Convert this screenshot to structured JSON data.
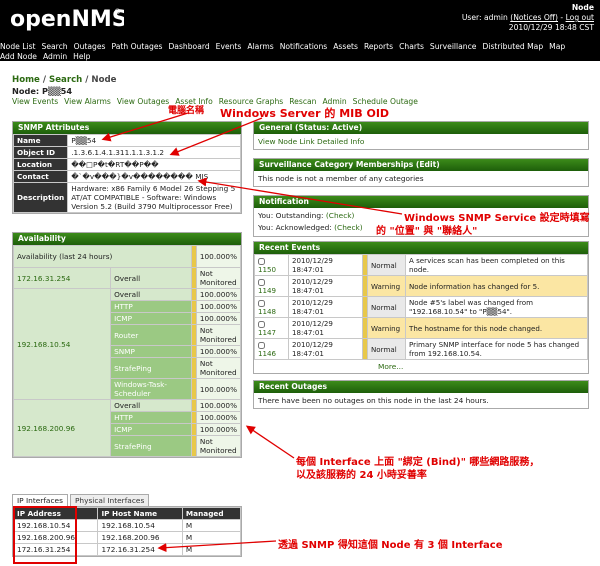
{
  "header": {
    "logo_text": "openNMS",
    "title": "Node",
    "user_line_prefix": "User:",
    "user_name": "admin",
    "notices": "(Notices Off)",
    "log_out": "Log out",
    "date": "2010/12/29",
    "time": "18:48 CST"
  },
  "topnav": [
    "Node List",
    "Search",
    "Outages",
    "Path Outages",
    "Dashboard",
    "Events",
    "Alarms",
    "Notifications",
    "Assets",
    "Reports",
    "Charts",
    "Surveillance",
    "Distributed Map",
    "Map",
    "Add Node",
    "Admin",
    "Help"
  ],
  "breadcrumb": {
    "home": "Home",
    "search": "Search",
    "node": "Node"
  },
  "node_label_prefix": "Node:",
  "node_label": "P▒▒54",
  "subnav": [
    "View Events",
    "View Alarms",
    "View Outages",
    "Asset Info",
    "Resource Graphs",
    "Rescan",
    "Admin",
    "Schedule Outage"
  ],
  "snmp": {
    "title": "SNMP Attributes",
    "rows": [
      {
        "label": "Name",
        "value": "P▒▒54"
      },
      {
        "label": "Object ID",
        "value": ".1.3.6.1.4.1.311.1.1.3.1.2"
      },
      {
        "label": "Location",
        "value": "��□P�t�RT��P��"
      },
      {
        "label": "Contact",
        "value": "�`�v���}�v�������� MIS"
      },
      {
        "label": "Description",
        "value": "Hardware: x86 Family 6 Model 26 Stepping 5 AT/AT COMPATIBLE - Software: Windows Version 5.2 (Build 3790 Multiprocessor Free)"
      }
    ]
  },
  "availability": {
    "title": "Availability",
    "head_label": "Availability (last 24 hours)",
    "head_value": "100.000%",
    "groups": [
      {
        "ip": "172.16.31.254",
        "rows": [
          {
            "service": "Overall",
            "value": "Not Monitored"
          }
        ]
      },
      {
        "ip": "192.168.10.54",
        "rows": [
          {
            "service": "Overall",
            "value": "100.000%"
          },
          {
            "service": "HTTP",
            "value": "100.000%"
          },
          {
            "service": "ICMP",
            "value": "100.000%"
          },
          {
            "service": "Router",
            "value": "Not Monitored"
          },
          {
            "service": "SNMP",
            "value": "100.000%"
          },
          {
            "service": "StrafePing",
            "value": "Not Monitored"
          },
          {
            "service": "Windows-Task-Scheduler",
            "value": "100.000%"
          }
        ]
      },
      {
        "ip": "192.168.200.96",
        "rows": [
          {
            "service": "Overall",
            "value": "100.000%"
          },
          {
            "service": "HTTP",
            "value": "100.000%"
          },
          {
            "service": "ICMP",
            "value": "100.000%"
          },
          {
            "service": "StrafePing",
            "value": "Not Monitored"
          }
        ]
      }
    ]
  },
  "iptabs": {
    "active": "IP Interfaces",
    "inactive": "Physical Interfaces"
  },
  "ip_table": {
    "headers": [
      "IP Address",
      "IP Host Name",
      "Managed"
    ],
    "rows": [
      [
        "192.168.10.54",
        "192.168.10.54",
        "M"
      ],
      [
        "192.168.200.96",
        "192.168.200.96",
        "M"
      ],
      [
        "172.16.31.254",
        "172.16.31.254",
        "M"
      ]
    ]
  },
  "general": {
    "title": "General (Status: Active)",
    "link": "View Node Link Detailed Info"
  },
  "surveillance": {
    "title": "Surveillance Category Memberships (Edit)",
    "text": "This node is not a member of any categories"
  },
  "notification": {
    "title": "Notification",
    "outstanding_label": "You: Outstanding:",
    "outstanding_link": "(Check)",
    "acknowledged_label": "You: Acknowledged:",
    "acknowledged_link": "(Check)"
  },
  "recent_events": {
    "title": "Recent Events",
    "rows": [
      {
        "id": "1150",
        "time": "2010/12/29 18:47:01",
        "severity": "Normal",
        "message": "A services scan has been completed on this node."
      },
      {
        "id": "1149",
        "time": "2010/12/29 18:47:01",
        "severity": "Warning",
        "message": "Node information has changed for 5."
      },
      {
        "id": "1148",
        "time": "2010/12/29 18:47:01",
        "severity": "Normal",
        "message": "Node #5's label was changed from \"192.168.10.54\" to \"P▒▒54\"."
      },
      {
        "id": "1147",
        "time": "2010/12/29 18:47:01",
        "severity": "Warning",
        "message": "The hostname for this node changed."
      },
      {
        "id": "1146",
        "time": "2010/12/29 18:47:01",
        "severity": "Normal",
        "message": "Primary SNMP interface for node 5 has changed from 192.168.10.54."
      }
    ],
    "more": "More..."
  },
  "recent_outages": {
    "title": "Recent Outages",
    "text": "There have been no outages on this node in the last 24 hours."
  },
  "annotations": {
    "computer_name": "電腦名稱",
    "mib_oid": "Windows Server 的 MIB OID",
    "snmp_service_1": "Windows SNMP Service 設定時填寫",
    "snmp_service_2": "的 \"位置\" 與 \"聯絡人\"",
    "bind_1": "每個 Interface 上面 \"綁定 (Bind)\" 哪些網路服務，",
    "bind_2": "以及該服務的 24 小時妥善率",
    "three_if": "透過 SNMP 得知這個 Node 有 3 個 Interface"
  },
  "colors": {
    "brand_green": "#1d5e0a",
    "annotation_red": "#e00000",
    "warning": "#fbe6a3"
  }
}
